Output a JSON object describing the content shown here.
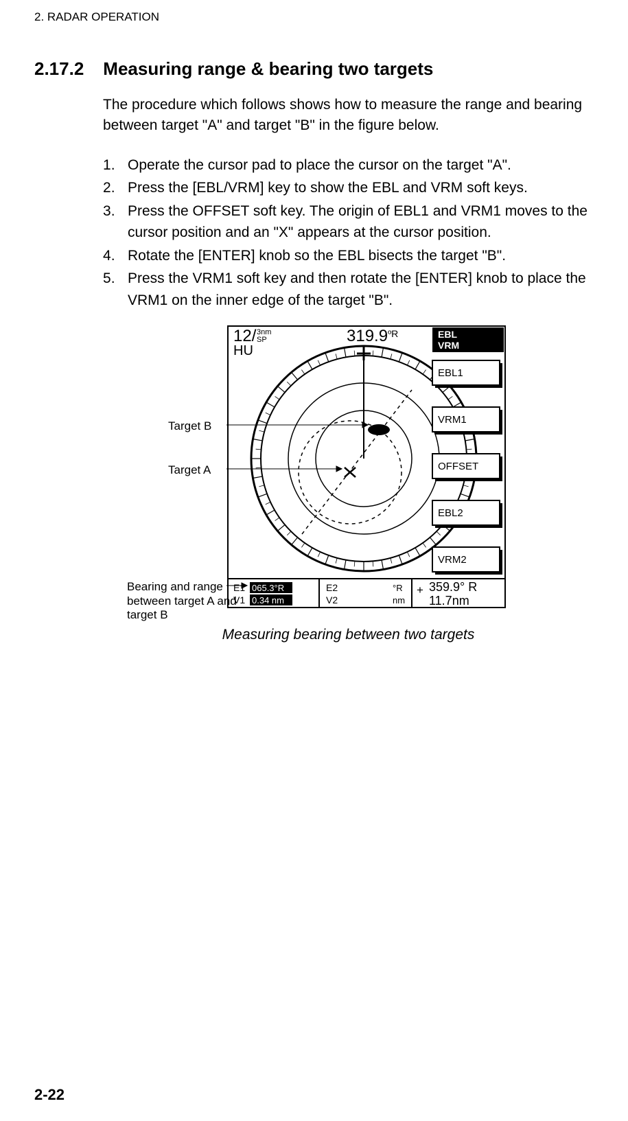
{
  "running_header": "2. RADAR OPERATION",
  "section": {
    "number": "2.17.2",
    "title": "Measuring range & bearing two targets"
  },
  "intro_para": "The procedure which follows shows how to measure the range and bearing between target \"A\" and target \"B\" in the figure below.",
  "steps": [
    "Operate the cursor pad to place the cursor on the target \"A\".",
    "Press the [EBL/VRM] key to show the EBL and VRM soft keys.",
    "Press the OFFSET soft key. The origin of EBL1 and VRM1 moves to the cursor position and an \"X\" appears at the cursor position.",
    "Rotate the [ENTER] knob so the EBL bisects the target \"B\".",
    "Press the VRM1 soft key and then rotate the [ENTER] knob to place the VRM1 on the inner edge of the target \"B\"."
  ],
  "figure": {
    "annotations": {
      "target_b": "Target B",
      "target_a": "Target A",
      "bearing_range": "Bearing and range between target A and target B"
    },
    "display": {
      "range_marker": "12/",
      "range_small_top": "3nm",
      "range_small_bottom": "SP",
      "mode": "HU",
      "heading": "319.9",
      "heading_unit": "ºR",
      "ev_box": {
        "e1_label": "E1",
        "e1_value": "065.3°R",
        "v1_label": "V1",
        "v1_value": "0.34 nm",
        "e2_label": "E2",
        "e2_unit": "°R",
        "v2_label": "V2",
        "v2_unit": "nm"
      },
      "cursor_box": {
        "bearing": "359.9° R",
        "range": "11.7nm",
        "cross": "+"
      },
      "softkeys": {
        "header_line1": "EBL",
        "header_line2": "VRM",
        "keys": [
          "EBL1",
          "VRM1",
          "OFFSET",
          "EBL2",
          "VRM2"
        ]
      }
    }
  },
  "caption": "Measuring bearing between two targets",
  "page_number": "2-22"
}
